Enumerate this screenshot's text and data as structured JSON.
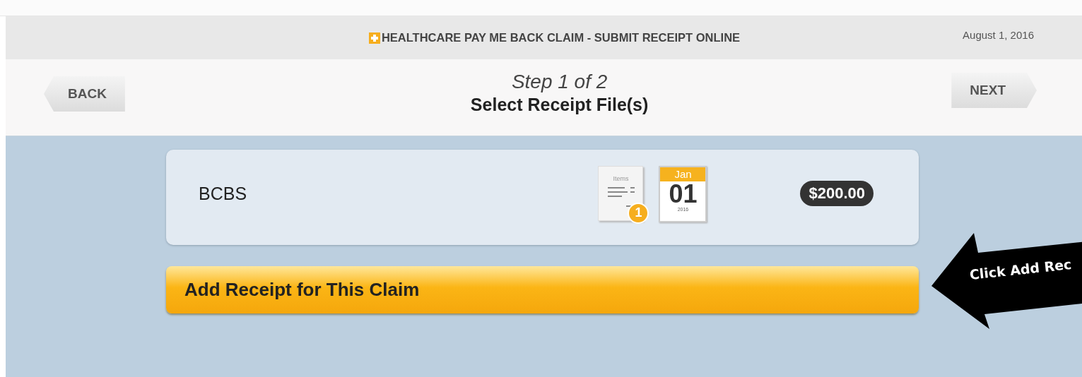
{
  "header": {
    "title": "HEALTHCARE PAY ME BACK CLAIM - SUBMIT RECEIPT ONLINE",
    "date": "August 1, 2016"
  },
  "step_bar": {
    "step": "Step 1 of 2",
    "heading": "Select Receipt File(s)",
    "back": "BACK",
    "next": "NEXT"
  },
  "claim": {
    "name": "BCBS",
    "items_label": "Items",
    "items_count": "1",
    "month": "Jan",
    "day": "01",
    "year": "2016",
    "amount": "$200.00"
  },
  "add_button": "Add Receipt for This Claim",
  "callout": "Click Add Rec"
}
